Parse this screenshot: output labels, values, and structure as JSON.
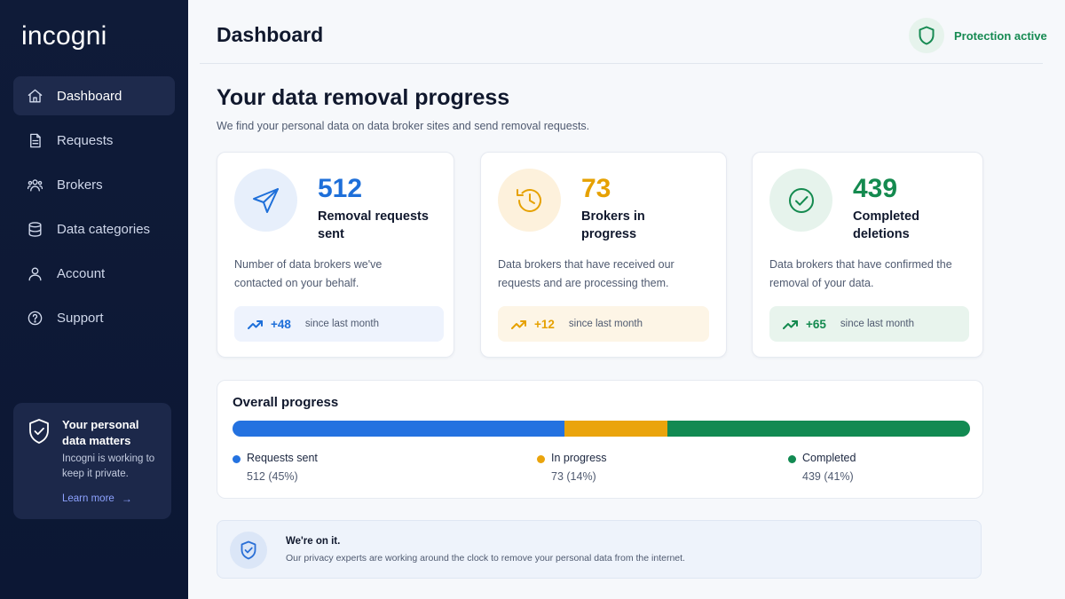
{
  "app": {
    "logo_text": "incogni"
  },
  "sidebar": {
    "items": [
      {
        "label": "Dashboard",
        "icon": "home-icon",
        "active": true
      },
      {
        "label": "Requests",
        "icon": "document-icon",
        "active": false
      },
      {
        "label": "Brokers",
        "icon": "users-icon",
        "active": false
      },
      {
        "label": "Data categories",
        "icon": "database-icon",
        "active": false
      },
      {
        "label": "Account",
        "icon": "user-icon",
        "active": false
      },
      {
        "label": "Support",
        "icon": "help-icon",
        "active": false
      }
    ],
    "promo": {
      "title": "Your personal data matters",
      "text": "Incogni is working to keep it private.",
      "link": "Learn more"
    }
  },
  "header": {
    "title": "Dashboard",
    "status": "Protection active"
  },
  "main": {
    "heading": "Your data removal progress",
    "subheading": "We find your personal data on data broker sites and send removal requests.",
    "cards": [
      {
        "value": "512",
        "label": "Removal requests sent",
        "description": "Number of data brokers we've contacted on your behalf.",
        "trend_value": "+48",
        "trend_label": "since last month",
        "icon": "send-icon",
        "color": "#1e6fd9"
      },
      {
        "value": "73",
        "label": "Brokers in progress",
        "description": "Data brokers that have received our requests and are processing them.",
        "trend_value": "+12",
        "trend_label": "since last month",
        "icon": "history-icon",
        "color": "#e6a100"
      },
      {
        "value": "439",
        "label": "Completed deletions",
        "description": "Data brokers that have confirmed the removal of your data.",
        "trend_value": "+65",
        "trend_label": "since last month",
        "icon": "check-circle-icon",
        "color": "#148a4f"
      }
    ],
    "overall": {
      "title": "Overall progress",
      "segments": [
        {
          "name": "Requests sent",
          "value_text": "512 (45%)",
          "percent": 45,
          "color": "#2472e0"
        },
        {
          "name": "In progress",
          "value_text": "73 (14%)",
          "percent": 14,
          "color": "#eaa40c"
        },
        {
          "name": "Completed",
          "value_text": "439 (41%)",
          "percent": 41,
          "color": "#128a52"
        }
      ]
    },
    "notice": {
      "title": "We're on it.",
      "text": "Our privacy experts are working around the clock to remove your personal data from the internet."
    }
  }
}
